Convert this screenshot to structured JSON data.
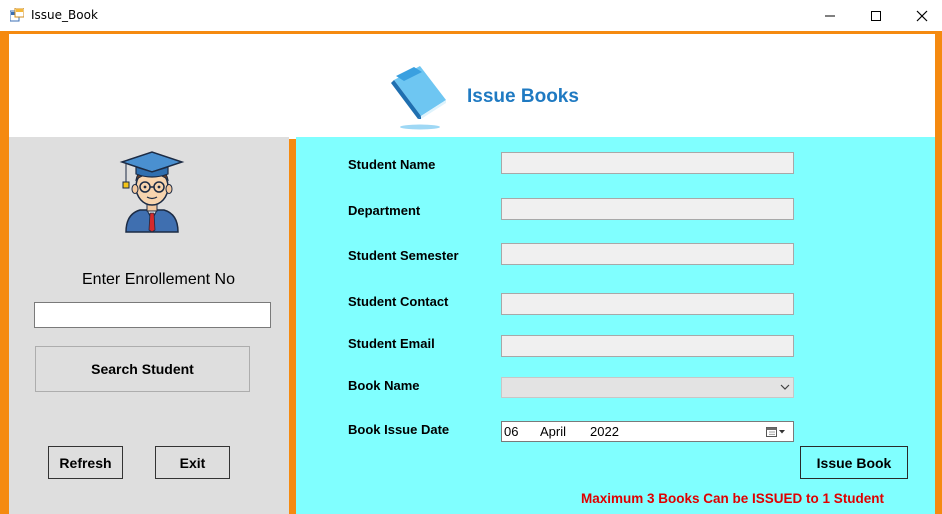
{
  "window": {
    "title": "Issue_Book",
    "controls": [
      "minimize-icon",
      "maximize-icon",
      "close-icon"
    ]
  },
  "header": {
    "title": "Issue Books",
    "icon": "book-icon"
  },
  "left_panel": {
    "avatar_icon": "graduate-student-icon",
    "enroll_label": "Enter Enrollement No",
    "enroll_value": "",
    "search_button": "Search Student",
    "refresh_button": "Refresh",
    "exit_button": "Exit"
  },
  "form": {
    "student_name": {
      "label": "Student Name",
      "value": ""
    },
    "department": {
      "label": "Department",
      "value": ""
    },
    "semester": {
      "label": "Student Semester",
      "value": ""
    },
    "contact": {
      "label": "Student Contact",
      "value": ""
    },
    "email": {
      "label": "Student Email",
      "value": ""
    },
    "book_name": {
      "label": "Book Name",
      "value": ""
    },
    "issue_date": {
      "label": "Book Issue Date",
      "day": "06",
      "month": "April",
      "year": "2022"
    },
    "issue_button": "Issue Book",
    "notice": "Maximum 3 Books Can be ISSUED to 1 Student"
  },
  "colors": {
    "accent_orange": "#f58a10",
    "form_background": "#80ffff",
    "left_panel_background": "#dedede",
    "title_blue": "#1f7ac2",
    "notice_red": "#e00000"
  }
}
